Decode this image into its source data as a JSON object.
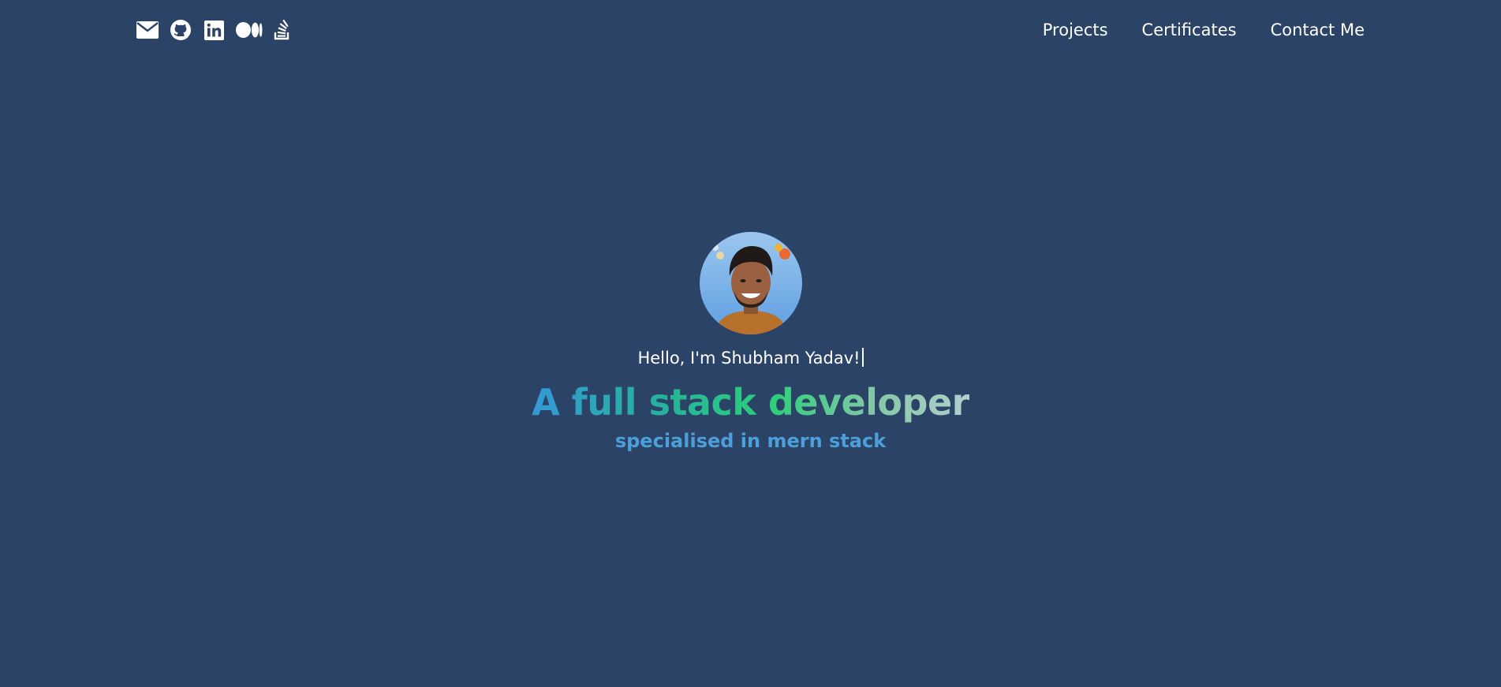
{
  "header": {
    "social": [
      {
        "name": "email",
        "icon": "envelope-icon"
      },
      {
        "name": "github",
        "icon": "github-icon"
      },
      {
        "name": "linkedin",
        "icon": "linkedin-icon"
      },
      {
        "name": "medium",
        "icon": "medium-icon"
      },
      {
        "name": "stackoverflow",
        "icon": "stackoverflow-icon"
      }
    ],
    "nav": {
      "projects": "Projects",
      "certificates": "Certificates",
      "contact": "Contact Me"
    }
  },
  "hero": {
    "greeting": "Hello, I'm Shubham Yadav!",
    "headline": "A full stack developer",
    "subline": "specialised in mern stack"
  },
  "colors": {
    "background": "#2b4367",
    "text": "#ffffff",
    "subline": "#4c9fd9",
    "headline_gradient": [
      "#3499d6",
      "#26b29b",
      "#2ecf7a",
      "#83c7a6",
      "#b2cfce"
    ]
  }
}
